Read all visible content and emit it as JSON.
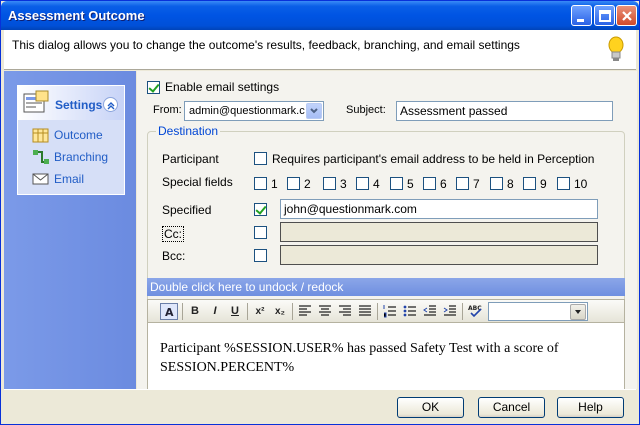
{
  "window": {
    "title": "Assessment Outcome",
    "controls": {
      "minimize_icon": "minimize-icon",
      "maximize_icon": "maximize-icon",
      "close_icon": "close-icon"
    }
  },
  "banner": {
    "text": "This dialog allows you to change the outcome's results, feedback, branching, and email settings",
    "icon": "lightbulb-icon"
  },
  "sidebar": {
    "header": "Settings",
    "items": [
      {
        "label": "Outcome",
        "icon": "outcome-icon"
      },
      {
        "label": "Branching",
        "icon": "branching-icon"
      },
      {
        "label": "Email",
        "icon": "email-icon"
      }
    ]
  },
  "email": {
    "enable_label": "Enable email settings",
    "enable_checked": true,
    "from_label": "From:",
    "from_value": "admin@questionmark.c",
    "subject_label": "Subject:",
    "subject_value": "Assessment passed"
  },
  "destination": {
    "legend": "Destination",
    "participant_label": "Participant",
    "participant_checkbox_label": "Requires participant's email address to be held in Perception",
    "special_label": "Special fields",
    "special_fields": [
      "1",
      "2",
      "3",
      "4",
      "5",
      "6",
      "7",
      "8",
      "9",
      "10"
    ],
    "specified_label": "Specified",
    "specified_value": "john@questionmark.com",
    "cc_label": "Cc:",
    "bcc_label": "Bcc:"
  },
  "editor": {
    "dock_label": "Double click here to undock / redock",
    "body_line1": "Participant %SESSION.USER% has passed Safety Test with a score of",
    "body_line2": "SESSION.PERCENT%",
    "toolbar": {
      "bold": "B",
      "italic": "I",
      "underline": "U",
      "superscript": "x²",
      "subscript": "x₂"
    }
  },
  "footer": {
    "ok_label": "OK",
    "cancel_label": "Cancel",
    "help_label": "Help"
  }
}
